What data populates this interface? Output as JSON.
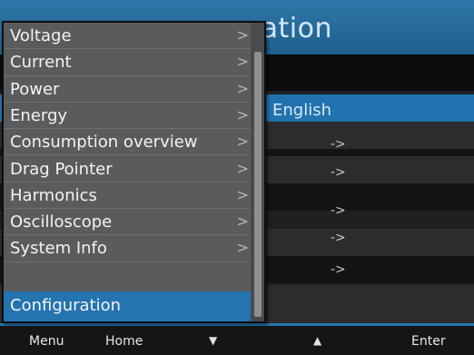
{
  "page": {
    "title": "Configuration",
    "title_visible": "ation",
    "selected_value": "English",
    "row_arrow": "->"
  },
  "menu": {
    "items": [
      {
        "label": "Voltage",
        "chevron": ">"
      },
      {
        "label": "Current",
        "chevron": ">"
      },
      {
        "label": "Power",
        "chevron": ">"
      },
      {
        "label": "Energy",
        "chevron": ">"
      },
      {
        "label": "Consumption overview",
        "chevron": ">"
      },
      {
        "label": "Drag Pointer",
        "chevron": ">"
      },
      {
        "label": "Harmonics",
        "chevron": ">"
      },
      {
        "label": "Oscilloscope",
        "chevron": ">"
      },
      {
        "label": "System Info",
        "chevron": ">"
      },
      {
        "label": "Configuration",
        "chevron": ""
      }
    ],
    "active_item": "Configuration"
  },
  "softkeys": {
    "menu": "Menu",
    "home": "Home",
    "down_icon": "triangle-down",
    "up_icon": "triangle-up",
    "enter": "Enter"
  },
  "colors": {
    "accent_blue": "#2474b0",
    "menu_bg": "#5a5b5c",
    "title_bar": "#2e77a9"
  }
}
